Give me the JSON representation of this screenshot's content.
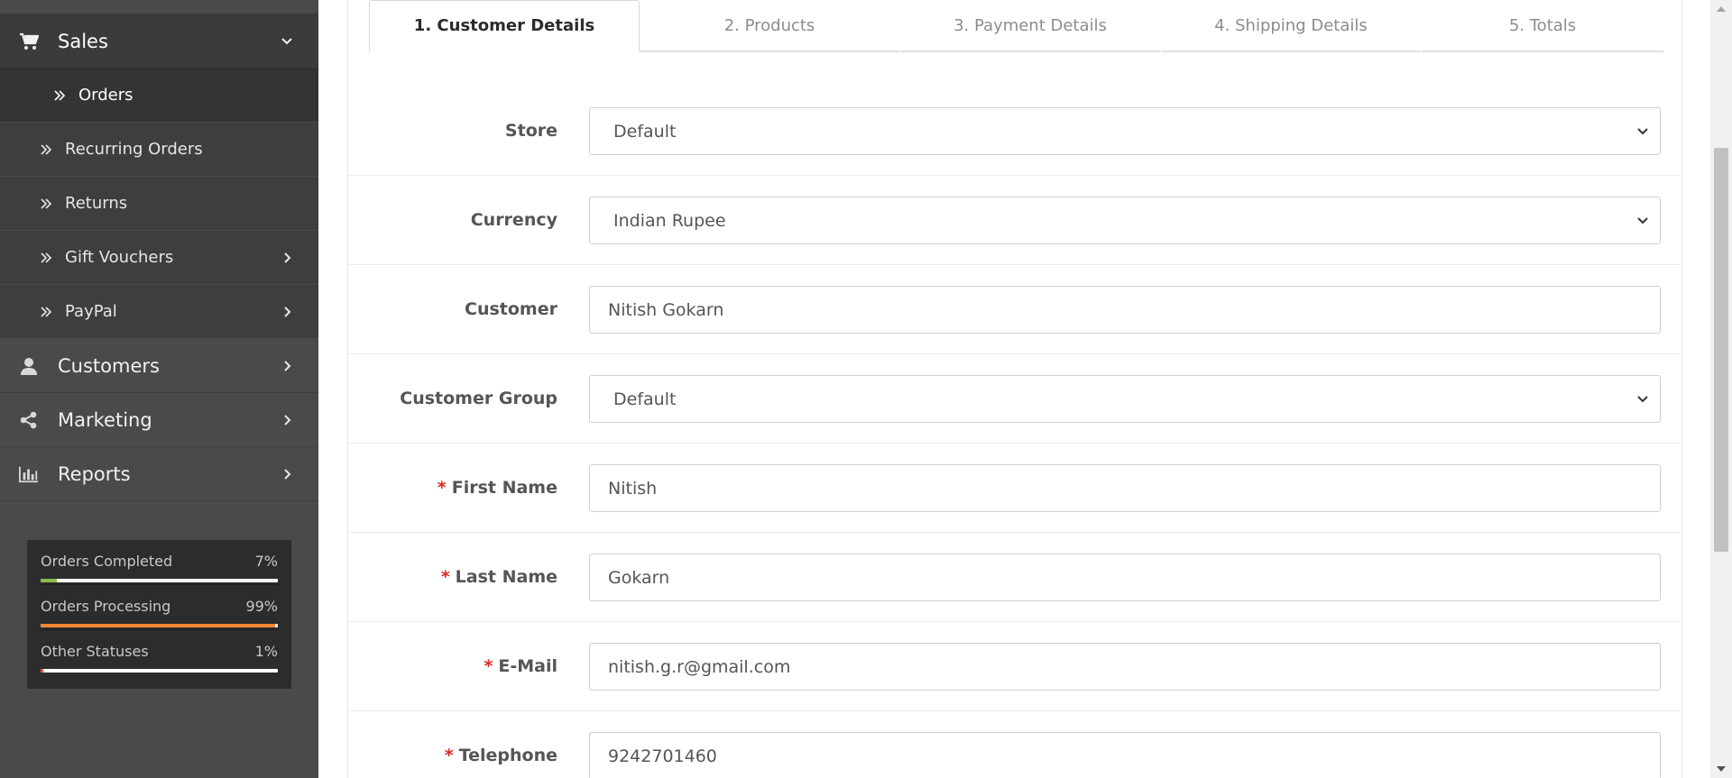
{
  "sidebar": {
    "sales": {
      "label": "Sales",
      "icon": "shopping-cart-icon"
    },
    "orders": {
      "label": "Orders"
    },
    "recurring_orders": {
      "label": "Recurring Orders"
    },
    "returns": {
      "label": "Returns"
    },
    "gift_vouchers": {
      "label": "Gift Vouchers"
    },
    "paypal": {
      "label": "PayPal"
    },
    "customers": {
      "label": "Customers",
      "icon": "user-icon"
    },
    "marketing": {
      "label": "Marketing",
      "icon": "share-icon"
    },
    "reports": {
      "label": "Reports",
      "icon": "bar-chart-icon"
    }
  },
  "stats": [
    {
      "label": "Orders Completed",
      "value": "7%",
      "percent": 7,
      "color": "#8fbb4c"
    },
    {
      "label": "Orders Processing",
      "value": "99%",
      "percent": 99,
      "color": "#f38733"
    },
    {
      "label": "Other Statuses",
      "value": "1%",
      "percent": 1,
      "color": "#e3503e"
    }
  ],
  "tabs": [
    {
      "label": "1. Customer Details",
      "active": true
    },
    {
      "label": "2. Products",
      "active": false
    },
    {
      "label": "3. Payment Details",
      "active": false
    },
    {
      "label": "4. Shipping Details",
      "active": false
    },
    {
      "label": "5. Totals",
      "active": false
    }
  ],
  "form": {
    "store": {
      "label": "Store",
      "value": "Default"
    },
    "currency": {
      "label": "Currency",
      "value": "Indian Rupee"
    },
    "customer": {
      "label": "Customer",
      "value": "Nitish Gokarn"
    },
    "customer_group": {
      "label": "Customer Group",
      "value": "Default"
    },
    "first_name": {
      "label": "First Name",
      "value": "Nitish",
      "required": "*"
    },
    "last_name": {
      "label": "Last Name",
      "value": "Gokarn",
      "required": "*"
    },
    "email": {
      "label": "E-Mail",
      "value": "nitish.g.r@gmail.com",
      "required": "*"
    },
    "telephone": {
      "label": "Telephone",
      "value": "9242701460",
      "required": "*"
    }
  }
}
